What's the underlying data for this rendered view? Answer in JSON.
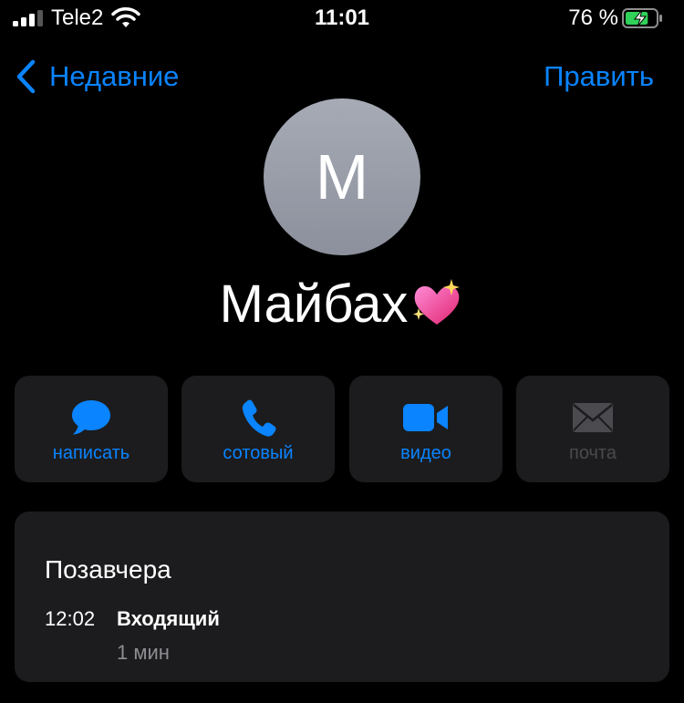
{
  "status_bar": {
    "carrier": "Tele2",
    "time": "11:01",
    "battery_percent": "76 %",
    "battery_level": 0.76,
    "charging": true
  },
  "nav": {
    "back_label": "Недавние",
    "edit_label": "Править"
  },
  "contact": {
    "avatar_initial": "M",
    "name": "Майбах",
    "emoji": "sparkling-heart"
  },
  "actions": [
    {
      "label": "написать",
      "icon": "message-bubble-icon",
      "enabled": true
    },
    {
      "label": "сотовый",
      "icon": "phone-icon",
      "enabled": true
    },
    {
      "label": "видео",
      "icon": "video-camera-icon",
      "enabled": true
    },
    {
      "label": "почта",
      "icon": "envelope-icon",
      "enabled": false
    }
  ],
  "recents": {
    "title": "Позавчера",
    "call_time": "12:02",
    "call_type": "Входящий",
    "duration": "1 мин"
  },
  "colors": {
    "accent": "#0a84ff",
    "tile_bg": "#1c1c1e",
    "disabled": "#4b4b4f"
  }
}
